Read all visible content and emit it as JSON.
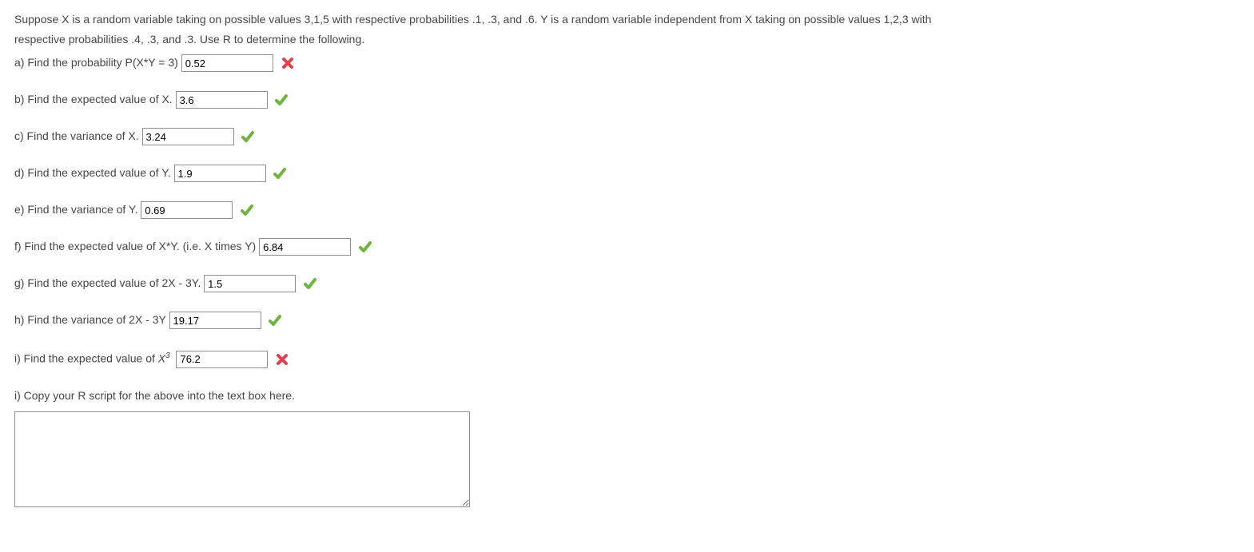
{
  "intro_line1": "Suppose X is a random variable taking on possible values 3,1,5 with respective probabilities .1, .3, and .6. Y is a random variable independent from X taking on possible values 1,2,3 with",
  "intro_line2": "respective probabilities .4, .3, and .3. Use R to determine the following.",
  "questions": {
    "a": {
      "label": "a) Find the probability P(X*Y = 3)",
      "value": "0.52",
      "mark": "wrong"
    },
    "b": {
      "label": "b) Find the expected value of X.",
      "value": "3.6",
      "mark": "correct"
    },
    "c": {
      "label": "c) Find the variance of X.",
      "value": "3.24",
      "mark": "correct"
    },
    "d": {
      "label": "d) Find the expected value of Y.",
      "value": "1.9",
      "mark": "correct"
    },
    "e": {
      "label": "e) Find the variance of Y.",
      "value": "0.69",
      "mark": "correct"
    },
    "f": {
      "label": "f) Find the expected value of X*Y. (i.e. X times Y)",
      "value": "6.84",
      "mark": "correct"
    },
    "g": {
      "label": "g) Find the expected value of 2X - 3Y.",
      "value": "1.5",
      "mark": "correct"
    },
    "h": {
      "label": "h) Find the variance of 2X - 3Y",
      "value": "19.17",
      "mark": "correct"
    },
    "i": {
      "label_prefix": "i) Find the expected value of ",
      "x_label": "X",
      "exp": "3",
      "value": "76.2",
      "mark": "wrong"
    },
    "script": {
      "label": "i) Copy your R script for the above into the text box here.",
      "value": ""
    }
  }
}
